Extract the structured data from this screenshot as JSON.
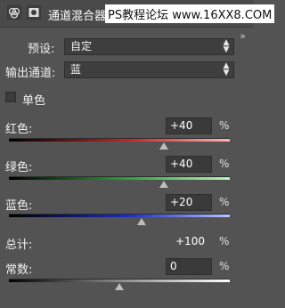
{
  "header": {
    "title": "通道混合器",
    "watermark": "PS教程论坛 www.16XX8.COM",
    "collapse_glyph": "»"
  },
  "preset": {
    "label": "预设:",
    "value": "自定"
  },
  "output": {
    "label": "输出通道:",
    "value": "蓝"
  },
  "monochrome": {
    "label": "单色",
    "checked": false
  },
  "channels": [
    {
      "label": "红色:",
      "value": "+40",
      "unit": "%",
      "level": 0.7
    },
    {
      "label": "绿色:",
      "value": "+40",
      "unit": "%",
      "level": 0.7
    },
    {
      "label": "蓝色:",
      "value": "+20",
      "unit": "%",
      "level": 0.6
    }
  ],
  "total": {
    "label": "总计:",
    "value": "+100",
    "unit": "%"
  },
  "constant": {
    "label": "常数:",
    "value": "0",
    "unit": "%",
    "level": 0.5
  },
  "colors": {
    "panel_bg": "#535353",
    "red": "#c8262a",
    "green": "#2fa53a",
    "blue": "#1a2fcb"
  }
}
